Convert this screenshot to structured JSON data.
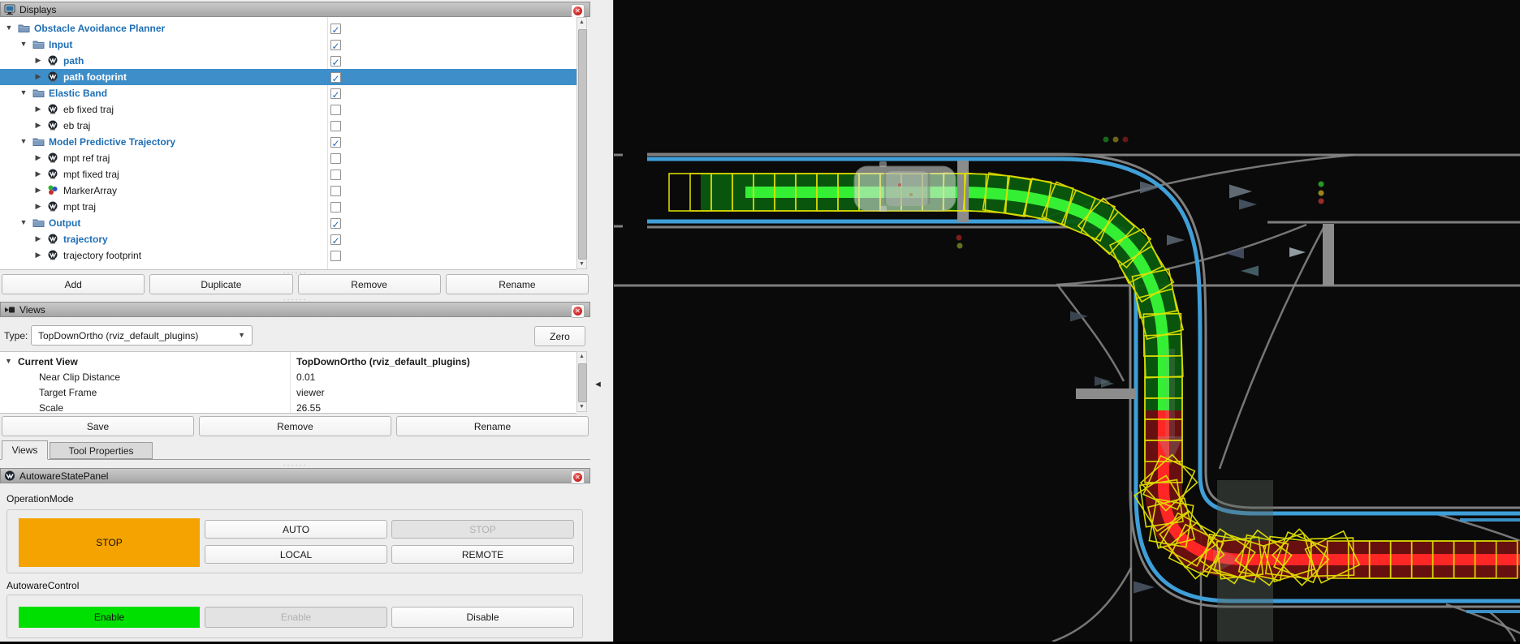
{
  "displays_panel": {
    "title": "Displays",
    "tree": [
      {
        "label": "Obstacle Avoidance Planner",
        "level": 0,
        "icon": "folder",
        "checked": true,
        "selected": false
      },
      {
        "label": "Input",
        "level": 1,
        "icon": "folder",
        "checked": true,
        "selected": false
      },
      {
        "label": "path",
        "level": 2,
        "icon": "autoware",
        "checked": true,
        "selected": false
      },
      {
        "label": "path footprint",
        "level": 2,
        "icon": "autoware",
        "checked": true,
        "selected": true
      },
      {
        "label": "Elastic Band",
        "level": 1,
        "icon": "folder",
        "checked": true,
        "selected": false
      },
      {
        "label": "eb fixed traj",
        "level": 2,
        "icon": "autoware",
        "checked": false,
        "selected": false
      },
      {
        "label": "eb traj",
        "level": 2,
        "icon": "autoware",
        "checked": false,
        "selected": false
      },
      {
        "label": "Model Predictive Trajectory",
        "level": 1,
        "icon": "folder",
        "checked": true,
        "selected": false
      },
      {
        "label": "mpt ref traj",
        "level": 2,
        "icon": "autoware",
        "checked": false,
        "selected": false
      },
      {
        "label": "mpt fixed traj",
        "level": 2,
        "icon": "autoware",
        "checked": false,
        "selected": false
      },
      {
        "label": "MarkerArray",
        "level": 2,
        "icon": "marker",
        "checked": false,
        "selected": false
      },
      {
        "label": "mpt traj",
        "level": 2,
        "icon": "autoware",
        "checked": false,
        "selected": false
      },
      {
        "label": "Output",
        "level": 1,
        "icon": "folder",
        "checked": true,
        "selected": false
      },
      {
        "label": "trajectory",
        "level": 2,
        "icon": "autoware",
        "checked": true,
        "selected": false
      },
      {
        "label": "trajectory footprint",
        "level": 2,
        "icon": "autoware",
        "checked": false,
        "selected": false
      }
    ],
    "buttons": {
      "add": "Add",
      "duplicate": "Duplicate",
      "remove": "Remove",
      "rename": "Rename"
    }
  },
  "views_panel": {
    "title": "Views",
    "type_label": "Type:",
    "type_value": "TopDownOrtho (rviz_default_plugins)",
    "zero_button": "Zero",
    "properties": [
      {
        "name": "Current View",
        "value": "TopDownOrtho (rviz_default_plugins)",
        "bold": true,
        "expand": true
      },
      {
        "name": "Near Clip Distance",
        "value": "0.01",
        "bold": false,
        "expand": false
      },
      {
        "name": "Target Frame",
        "value": "viewer",
        "bold": false,
        "expand": false
      },
      {
        "name": "Scale",
        "value": "26.55",
        "bold": false,
        "expand": false
      }
    ],
    "buttons": {
      "save": "Save",
      "remove": "Remove",
      "rename": "Rename"
    },
    "tabs": [
      {
        "label": "Views",
        "active": true
      },
      {
        "label": "Tool Properties",
        "active": false
      }
    ]
  },
  "autoware_state_panel": {
    "title": "AutowareStatePanel",
    "operation_mode": {
      "label": "OperationMode",
      "current_state": "STOP",
      "buttons": [
        {
          "label": "AUTO",
          "enabled": true
        },
        {
          "label": "STOP",
          "enabled": false
        },
        {
          "label": "LOCAL",
          "enabled": true
        },
        {
          "label": "REMOTE",
          "enabled": true
        }
      ]
    },
    "autoware_control": {
      "label": "AutowareControl",
      "current_state": "Enable",
      "buttons": [
        {
          "label": "Enable",
          "enabled": false
        },
        {
          "label": "Disable",
          "enabled": true
        }
      ]
    }
  },
  "colors": {
    "stop_orange": "#f5a300",
    "enable_green": "#00e000",
    "selection_blue": "#3d8ec9",
    "tree_enabled_blue": "#1f6fb5",
    "lanelet_blue": "#3f9fd8",
    "map_gray": "#7f7f7f",
    "decor_gray": "#8a8a8a",
    "traj_green_dark": "#0b5a0e",
    "traj_green_bright": "#35ef35",
    "traj_red_dark": "#6e1111",
    "traj_red_bright": "#ff2626",
    "footprint_yellow": "#e2e200",
    "stopline_gray": "#8c8c8c"
  }
}
